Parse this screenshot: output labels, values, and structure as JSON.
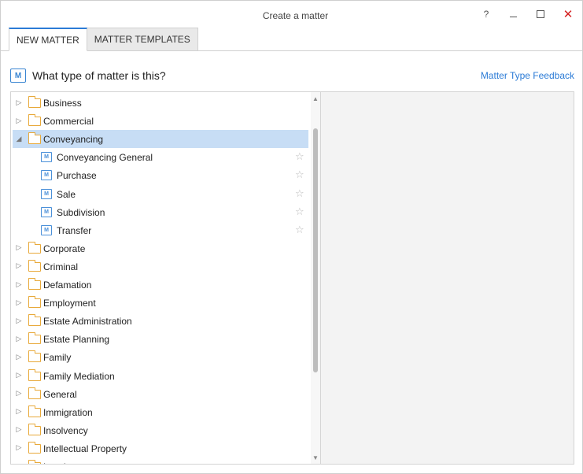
{
  "window": {
    "title": "Create a matter",
    "help_glyph": "?",
    "close_glyph": "✕"
  },
  "tabs": [
    {
      "label": "NEW MATTER",
      "active": true
    },
    {
      "label": "MATTER TEMPLATES",
      "active": false
    }
  ],
  "header": {
    "icon_letter": "M",
    "prompt": "What type of matter is this?",
    "feedback_link": "Matter Type Feedback"
  },
  "tree": {
    "collapsed_glyph": "▷",
    "expanded_glyph": "◢",
    "star_glyph": "☆",
    "leaf_icon_letter": "M",
    "items": [
      {
        "label": "Business",
        "kind": "folder",
        "state": "collapsed"
      },
      {
        "label": "Commercial",
        "kind": "folder",
        "state": "collapsed"
      },
      {
        "label": "Conveyancing",
        "kind": "folder",
        "state": "expanded",
        "selected": true
      },
      {
        "label": "Conveyancing General",
        "kind": "matter-type"
      },
      {
        "label": "Purchase",
        "kind": "matter-type"
      },
      {
        "label": "Sale",
        "kind": "matter-type"
      },
      {
        "label": "Subdivision",
        "kind": "matter-type"
      },
      {
        "label": "Transfer",
        "kind": "matter-type"
      },
      {
        "label": "Corporate",
        "kind": "folder",
        "state": "collapsed"
      },
      {
        "label": "Criminal",
        "kind": "folder",
        "state": "collapsed"
      },
      {
        "label": "Defamation",
        "kind": "folder",
        "state": "collapsed"
      },
      {
        "label": "Employment",
        "kind": "folder",
        "state": "collapsed"
      },
      {
        "label": "Estate Administration",
        "kind": "folder",
        "state": "collapsed"
      },
      {
        "label": "Estate Planning",
        "kind": "folder",
        "state": "collapsed"
      },
      {
        "label": "Family",
        "kind": "folder",
        "state": "collapsed"
      },
      {
        "label": "Family Mediation",
        "kind": "folder",
        "state": "collapsed"
      },
      {
        "label": "General",
        "kind": "folder",
        "state": "collapsed"
      },
      {
        "label": "Immigration",
        "kind": "folder",
        "state": "collapsed"
      },
      {
        "label": "Insolvency",
        "kind": "folder",
        "state": "collapsed"
      },
      {
        "label": "Intellectual Property",
        "kind": "folder",
        "state": "collapsed"
      },
      {
        "label": "Leasing",
        "kind": "folder",
        "state": "collapsed"
      }
    ]
  },
  "colors": {
    "accent": "#2b7bd6",
    "selection": "#c7ddf5",
    "folder": "#e8a93a",
    "close": "#d42020"
  }
}
